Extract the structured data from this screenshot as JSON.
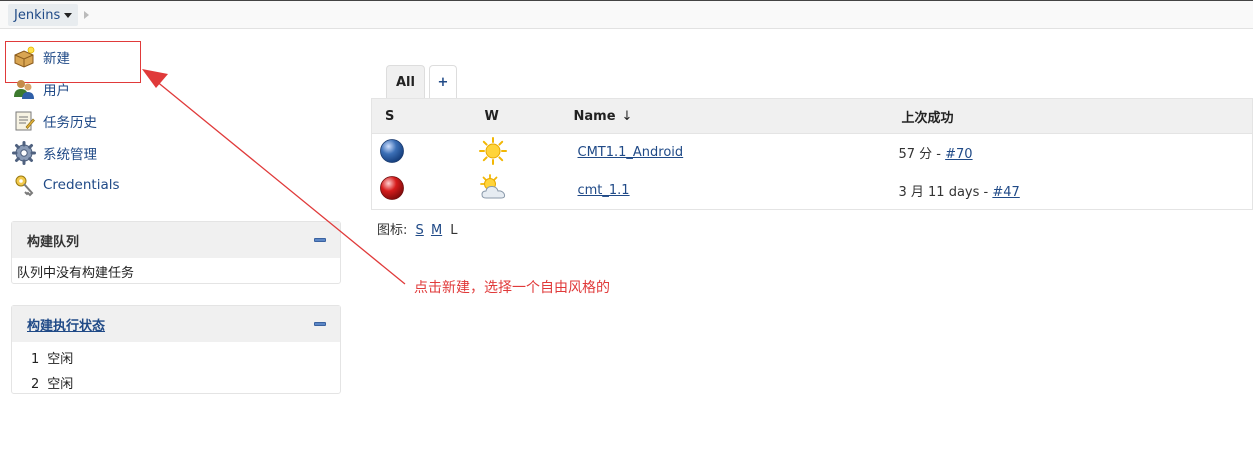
{
  "breadcrumb": {
    "root": "Jenkins"
  },
  "tasks": [
    {
      "label": "新建",
      "icon": "new-item-icon"
    },
    {
      "label": "用户",
      "icon": "users-icon"
    },
    {
      "label": "任务历史",
      "icon": "history-icon"
    },
    {
      "label": "系统管理",
      "icon": "gear-icon"
    },
    {
      "label": "Credentials",
      "icon": "credentials-icon"
    }
  ],
  "build_queue": {
    "title": "构建队列",
    "empty_text": "队列中没有构建任务"
  },
  "executors": {
    "title": "构建执行状态",
    "rows": [
      {
        "num": "1",
        "status": "空闲"
      },
      {
        "num": "2",
        "status": "空闲"
      }
    ]
  },
  "tabs": {
    "all": "All",
    "add": "+"
  },
  "table": {
    "headers": {
      "s": "S",
      "w": "W",
      "name": "Name",
      "name_sort": "↓",
      "last_success": "上次成功"
    },
    "rows": [
      {
        "status": "blue",
        "weather": "sunny",
        "name": "CMT1.1_Android",
        "last_success_text": "57 分 - ",
        "build": "#70"
      },
      {
        "status": "red",
        "weather": "partly-cloudy",
        "name": "cmt_1.1",
        "last_success_text": "3 月 11 days - ",
        "build": "#47"
      }
    ]
  },
  "icon_legend": {
    "label": "图标:",
    "s": "S",
    "m": "M",
    "l": "L"
  },
  "annotation": {
    "text": "点击新建，选择一个自由风格的",
    "color": "#e03a3a"
  },
  "colors": {
    "link": "#204a87",
    "status_blue": "#3b6fb6",
    "status_red": "#d61c1c"
  }
}
